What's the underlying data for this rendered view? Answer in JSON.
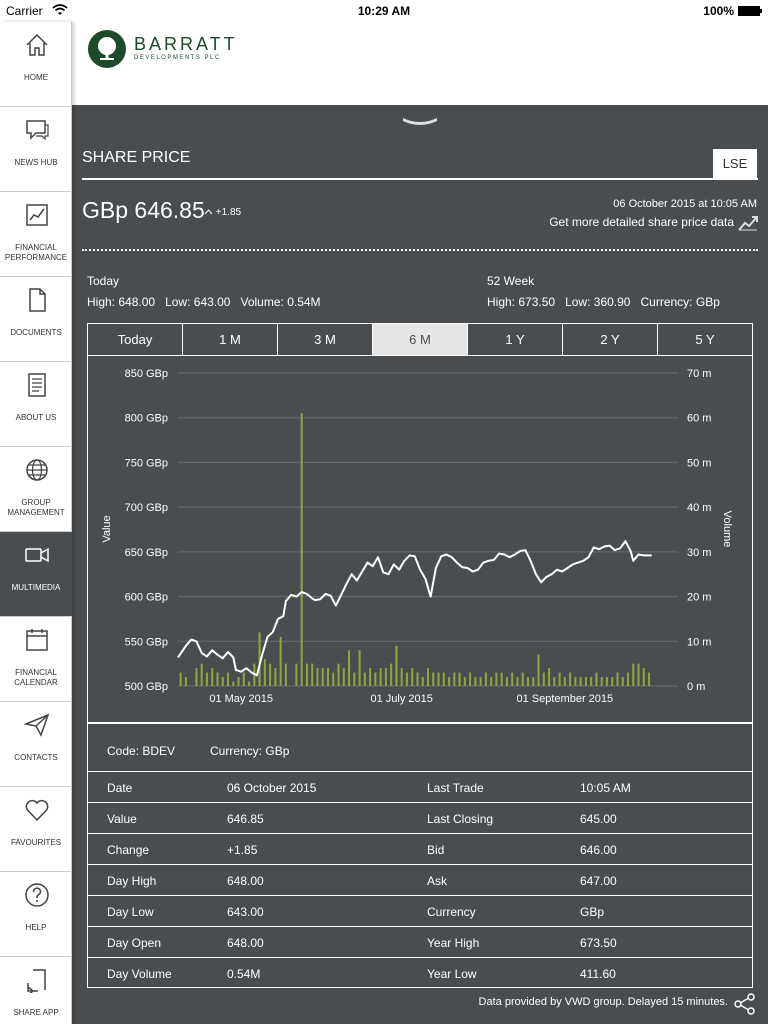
{
  "status_bar": {
    "carrier": "Carrier",
    "time": "10:29 AM",
    "battery": "100%"
  },
  "sidebar": {
    "items": [
      {
        "label": "HOME",
        "icon": "home-icon"
      },
      {
        "label": "NEWS HUB",
        "icon": "chat-bubble-icon"
      },
      {
        "label": "FINANCIAL PERFORMANCE",
        "icon": "line-chart-icon"
      },
      {
        "label": "DOCUMENTS",
        "icon": "document-icon"
      },
      {
        "label": "ABOUT US",
        "icon": "text-page-icon"
      },
      {
        "label": "GROUP MANAGEMENT",
        "icon": "globe-icon"
      },
      {
        "label": "MULTIMEDIA",
        "icon": "video-camera-icon",
        "active": true
      },
      {
        "label": "FINANCIAL CALENDAR",
        "icon": "calendar-icon"
      },
      {
        "label": "CONTACTS",
        "icon": "paper-plane-icon"
      },
      {
        "label": "FAVOURITES",
        "icon": "heart-icon"
      },
      {
        "label": "HELP",
        "icon": "question-icon"
      },
      {
        "label": "SHARE APP",
        "icon": "share-out-icon"
      }
    ]
  },
  "header": {
    "logo_name": "BARRATT",
    "logo_sub": "DEVELOPMENTS PLC",
    "brand_color": "#1d4a2a"
  },
  "share_price": {
    "title": "SHARE PRICE",
    "exchange": "LSE",
    "price": "GBp 646.85",
    "change": "+1.85",
    "datetime": "06 October 2015 at 10:05 AM",
    "more_link": "Get more detailed share price data"
  },
  "today": {
    "heading": "Today",
    "high_label": "High:",
    "high": "648.00",
    "low_label": "Low:",
    "low": "643.00",
    "volume_label": "Volume:",
    "volume": "0.54M"
  },
  "week52": {
    "heading": "52 Week",
    "high_label": "High:",
    "high": "673.50",
    "low_label": "Low:",
    "low": "360.90",
    "currency_label": "Currency:",
    "currency": "GBp"
  },
  "tabs": [
    "Today",
    "1 M",
    "3 M",
    "6 M",
    "1 Y",
    "2 Y",
    "5 Y"
  ],
  "active_tab": "6 M",
  "chart_data": {
    "type": "line",
    "ylabel": "Value",
    "y2label": "Volume",
    "ylim": [
      500,
      850
    ],
    "y2lim": [
      0,
      70
    ],
    "y_ticks": [
      "850 GBp",
      "800 GBp",
      "750 GBp",
      "700 GBp",
      "650 GBp",
      "600 GBp",
      "550 GBp",
      "500 GBp"
    ],
    "y2_ticks": [
      "70 m",
      "60 m",
      "50 m",
      "40 m",
      "30 m",
      "20 m",
      "10 m",
      "0 m"
    ],
    "x_ticks": [
      "01 May 2015",
      "01 July 2015",
      "01 September 2015"
    ],
    "x_tick_days": [
      24,
      85,
      147
    ],
    "x_range_days": [
      0,
      190
    ],
    "line_color": "#ffffff",
    "bar_color": "#8fa83c",
    "price_series": [
      [
        0,
        532
      ],
      [
        3,
        545
      ],
      [
        5,
        552
      ],
      [
        7,
        550
      ],
      [
        9,
        537
      ],
      [
        11,
        533
      ],
      [
        13,
        540
      ],
      [
        15,
        535
      ],
      [
        17,
        531
      ],
      [
        19,
        538
      ],
      [
        21,
        532
      ],
      [
        22,
        518
      ],
      [
        24,
        516
      ],
      [
        26,
        520
      ],
      [
        28,
        515
      ],
      [
        30,
        512
      ],
      [
        32,
        535
      ],
      [
        34,
        555
      ],
      [
        36,
        560
      ],
      [
        38,
        575
      ],
      [
        40,
        578
      ],
      [
        41,
        595
      ],
      [
        43,
        602
      ],
      [
        45,
        600
      ],
      [
        47,
        605
      ],
      [
        49,
        603
      ],
      [
        51,
        598
      ],
      [
        52,
        596
      ],
      [
        54,
        597
      ],
      [
        56,
        603
      ],
      [
        58,
        601
      ],
      [
        60,
        590
      ],
      [
        62,
        602
      ],
      [
        64,
        614
      ],
      [
        66,
        625
      ],
      [
        68,
        618
      ],
      [
        70,
        628
      ],
      [
        72,
        638
      ],
      [
        74,
        634
      ],
      [
        76,
        644
      ],
      [
        78,
        627
      ],
      [
        80,
        625
      ],
      [
        82,
        636
      ],
      [
        84,
        630
      ],
      [
        86,
        640
      ],
      [
        88,
        646
      ],
      [
        90,
        645
      ],
      [
        92,
        630
      ],
      [
        94,
        620
      ],
      [
        96,
        600
      ],
      [
        98,
        632
      ],
      [
        100,
        645
      ],
      [
        102,
        647
      ],
      [
        104,
        644
      ],
      [
        106,
        638
      ],
      [
        108,
        633
      ],
      [
        110,
        632
      ],
      [
        112,
        628
      ],
      [
        114,
        630
      ],
      [
        116,
        638
      ],
      [
        118,
        640
      ],
      [
        120,
        641
      ],
      [
        122,
        648
      ],
      [
        124,
        647
      ],
      [
        126,
        644
      ],
      [
        128,
        647
      ],
      [
        130,
        651
      ],
      [
        132,
        652
      ],
      [
        134,
        640
      ],
      [
        136,
        625
      ],
      [
        138,
        616
      ],
      [
        140,
        622
      ],
      [
        142,
        625
      ],
      [
        144,
        630
      ],
      [
        146,
        628
      ],
      [
        148,
        632
      ],
      [
        150,
        636
      ],
      [
        152,
        638
      ],
      [
        154,
        640
      ],
      [
        156,
        644
      ],
      [
        158,
        655
      ],
      [
        160,
        653
      ],
      [
        162,
        656
      ],
      [
        164,
        657
      ],
      [
        166,
        652
      ],
      [
        168,
        654
      ],
      [
        170,
        662
      ],
      [
        172,
        651
      ],
      [
        173,
        640
      ],
      [
        175,
        647
      ],
      [
        177,
        646
      ],
      [
        180,
        646
      ]
    ],
    "volume_series": [
      [
        1,
        3
      ],
      [
        3,
        2
      ],
      [
        7,
        4
      ],
      [
        9,
        5
      ],
      [
        11,
        3
      ],
      [
        13,
        4
      ],
      [
        15,
        3
      ],
      [
        17,
        2
      ],
      [
        19,
        3
      ],
      [
        21,
        1
      ],
      [
        23,
        2
      ],
      [
        25,
        3
      ],
      [
        27,
        1
      ],
      [
        29,
        5
      ],
      [
        31,
        12
      ],
      [
        33,
        6
      ],
      [
        35,
        5
      ],
      [
        37,
        4
      ],
      [
        39,
        11
      ],
      [
        41,
        5
      ],
      [
        45,
        5
      ],
      [
        47,
        61
      ],
      [
        49,
        5
      ],
      [
        51,
        5
      ],
      [
        53,
        4
      ],
      [
        55,
        4
      ],
      [
        57,
        4
      ],
      [
        59,
        3
      ],
      [
        61,
        5
      ],
      [
        63,
        4
      ],
      [
        65,
        8
      ],
      [
        67,
        3
      ],
      [
        69,
        8
      ],
      [
        71,
        3
      ],
      [
        73,
        4
      ],
      [
        75,
        3
      ],
      [
        77,
        4
      ],
      [
        79,
        4
      ],
      [
        81,
        5
      ],
      [
        83,
        9
      ],
      [
        85,
        4
      ],
      [
        87,
        3
      ],
      [
        89,
        4
      ],
      [
        91,
        3
      ],
      [
        93,
        2
      ],
      [
        95,
        4
      ],
      [
        97,
        3
      ],
      [
        99,
        3
      ],
      [
        101,
        3
      ],
      [
        103,
        2
      ],
      [
        105,
        3
      ],
      [
        107,
        3
      ],
      [
        109,
        2
      ],
      [
        111,
        3
      ],
      [
        113,
        2
      ],
      [
        115,
        2
      ],
      [
        117,
        3
      ],
      [
        119,
        2
      ],
      [
        121,
        3
      ],
      [
        123,
        3
      ],
      [
        125,
        2
      ],
      [
        127,
        3
      ],
      [
        129,
        2
      ],
      [
        131,
        3
      ],
      [
        133,
        2
      ],
      [
        135,
        2
      ],
      [
        137,
        7
      ],
      [
        139,
        3
      ],
      [
        141,
        4
      ],
      [
        143,
        2
      ],
      [
        145,
        3
      ],
      [
        147,
        2
      ],
      [
        149,
        3
      ],
      [
        151,
        2
      ],
      [
        153,
        2
      ],
      [
        155,
        2
      ],
      [
        157,
        2
      ],
      [
        159,
        3
      ],
      [
        161,
        2
      ],
      [
        163,
        2
      ],
      [
        165,
        2
      ],
      [
        167,
        3
      ],
      [
        169,
        2
      ],
      [
        171,
        3
      ],
      [
        173,
        5
      ],
      [
        175,
        5
      ],
      [
        177,
        4
      ],
      [
        179,
        3
      ]
    ]
  },
  "info": {
    "code_label": "Code:",
    "code": "BDEV",
    "currency_label": "Currency:",
    "currency": "GBp",
    "rows": [
      {
        "l1": "Date",
        "v1": "06 October 2015",
        "l2": "Last Trade",
        "v2": "10:05 AM"
      },
      {
        "l1": "Value",
        "v1": "646.85",
        "l2": "Last Closing",
        "v2": "645.00"
      },
      {
        "l1": "Change",
        "v1": "+1.85",
        "l2": "Bid",
        "v2": "646.00"
      },
      {
        "l1": "Day High",
        "v1": "648.00",
        "l2": "Ask",
        "v2": "647.00"
      },
      {
        "l1": "Day Low",
        "v1": "643.00",
        "l2": "Currency",
        "v2": "GBp"
      },
      {
        "l1": "Day Open",
        "v1": "648.00",
        "l2": "Year High",
        "v2": "673.50"
      },
      {
        "l1": "Day Volume",
        "v1": "0.54M",
        "l2": "Year Low",
        "v2": "411.60"
      }
    ]
  },
  "footer": {
    "note": "Data provided by VWD group. Delayed 15 minutes."
  }
}
